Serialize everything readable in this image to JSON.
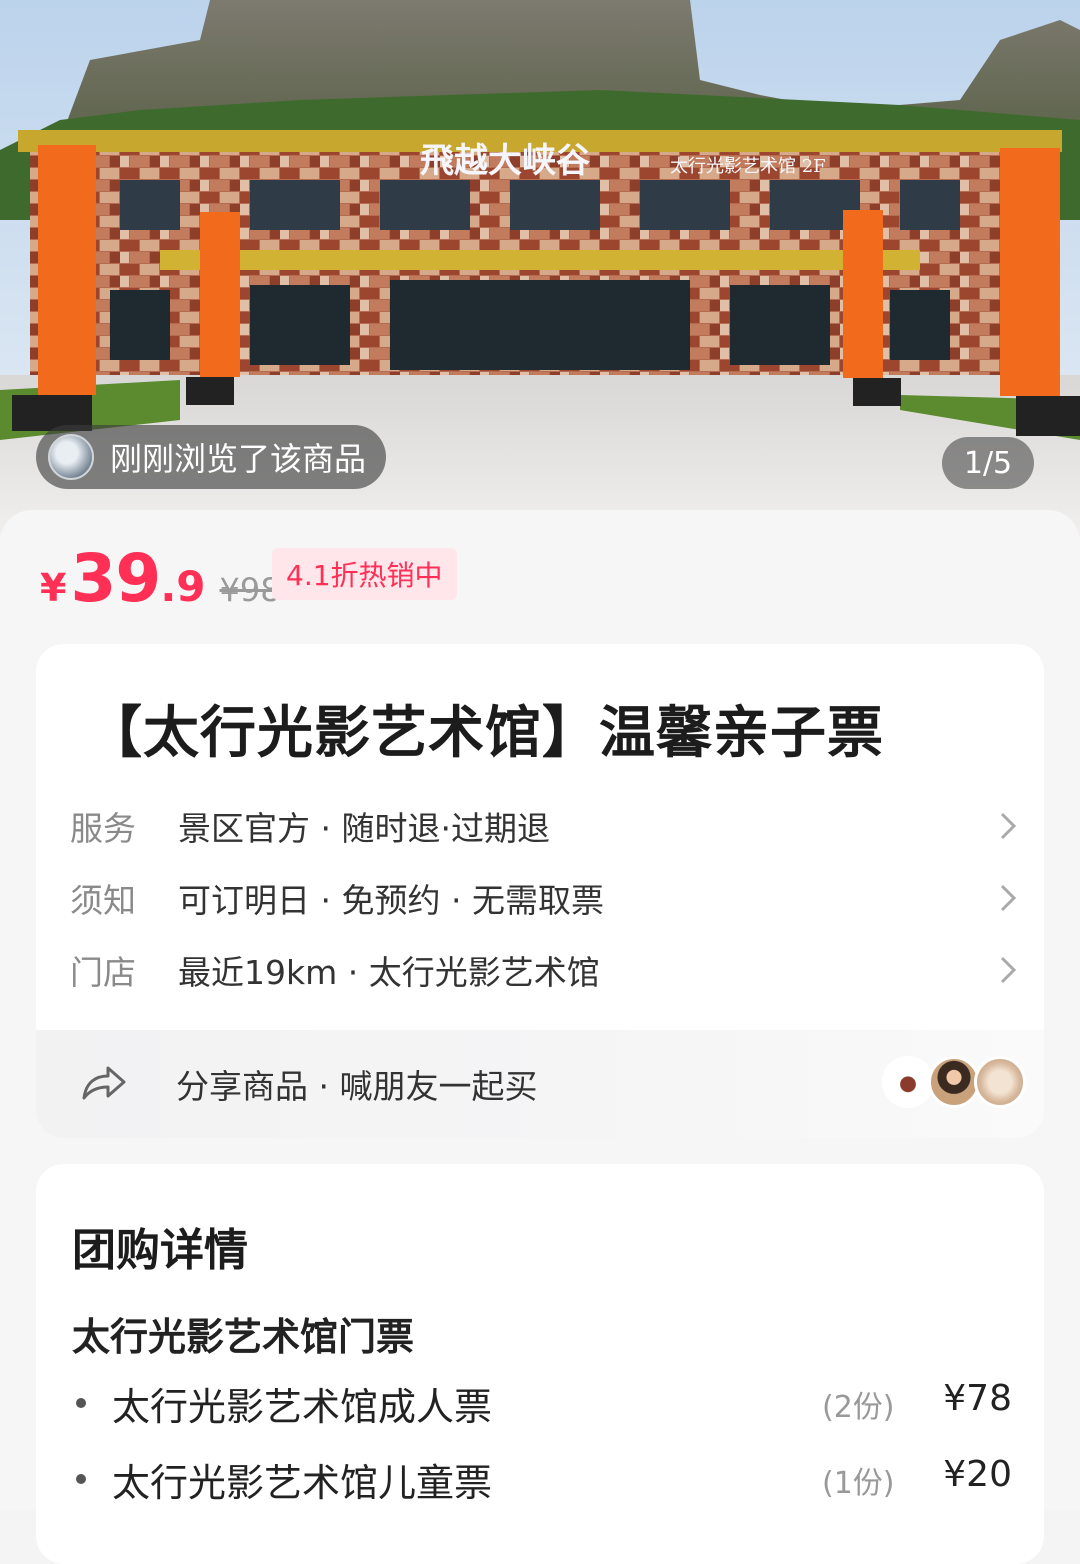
{
  "hero": {
    "viewed_text": "刚刚浏览了该商品",
    "counter": "1/5",
    "sign_main": "飛越大峡谷",
    "sign_sub": "太行光影艺术馆 2F",
    "banner_text": "太行光影艺术馆"
  },
  "price": {
    "currency": "¥",
    "integer": "39",
    "decimal": ".9",
    "original": "¥98",
    "discount": "4.1折热销中"
  },
  "product": {
    "title": "【太行光影艺术馆】温馨亲子票",
    "rows": [
      {
        "label": "服务",
        "value": "景区官方 · 随时退·过期退"
      },
      {
        "label": "须知",
        "value": "可订明日 · 免预约 · 无需取票"
      },
      {
        "label": "门店",
        "value": "最近19km · 太行光影艺术馆"
      }
    ],
    "share": "分享商品 · 喊朋友一起买"
  },
  "details": {
    "title": "团购详情",
    "subtitle": "太行光影艺术馆门票",
    "items": [
      {
        "name": "太行光影艺术馆成人票",
        "qty": "(2份)",
        "price": "¥78"
      },
      {
        "name": "太行光影艺术馆儿童票",
        "qty": "(1份)",
        "price": "¥20"
      }
    ]
  },
  "colors": {
    "accent": "#ff2f55",
    "banner": "#f26a1b",
    "building_brick": "#a5523d"
  },
  "icons": [
    "chevron-right-icon",
    "share-arrow-icon"
  ]
}
